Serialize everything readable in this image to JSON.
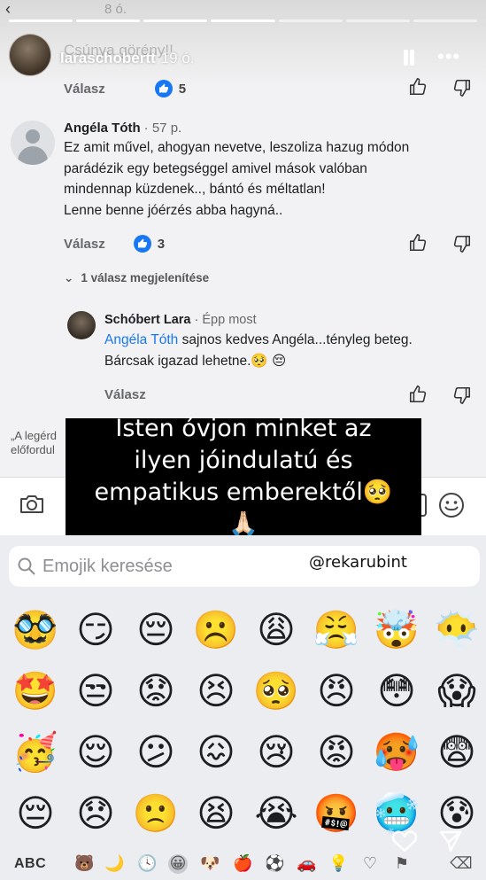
{
  "story": {
    "username": "laraschobertt",
    "time": "19 ó.",
    "top_time": "8 ó.",
    "behind_text": "Csúnya görény!!"
  },
  "comments": [
    {
      "name": "Angéla Tóth",
      "ago": "57 p.",
      "lines": [
        "Ez amit művel, ahogyan nevetve, leszoliza hazug módon",
        "parádézik egy betegséggel amivel mások valóban",
        "mindennap küzdenek.., bántó és méltatlan!",
        "Lenne benne jóérzés abba hagyná.."
      ],
      "reply_label": "Válasz",
      "likes": "3"
    }
  ],
  "first_row": {
    "reply_label": "Válasz",
    "likes": "5"
  },
  "replies_toggle": "1 válasz megjelenítése",
  "reply": {
    "name": "Schóbert Lara",
    "ago": "Épp most",
    "mention": "Angéla Tóth",
    "line1": " sajnos kedves Angéla...tényleg beteg.",
    "line2": "Bárcsak igazad lehetne.🥺 😔",
    "reply_label": "Válasz"
  },
  "quote_text": {
    "line1": "„A legérd",
    "line2": "előfordul"
  },
  "caption": "Isten óvjon minket az ilyen jóindulatú és empatikus emberektől🥺🙏🏻",
  "keyboard": {
    "search_placeholder": "Emojik keresése",
    "handle_tag": "@rekarubint",
    "abc_label": "ABC",
    "emojis": [
      "🥸",
      "😏",
      "😔",
      "☹️",
      "😩",
      "😤",
      "🤯",
      "😶‍🌫️",
      "🤩",
      "😒",
      "😟",
      "😣",
      "🥺",
      "😠",
      "😳",
      "😱",
      "🥳",
      "😌",
      "😕",
      "😖",
      "😢",
      "😡",
      "🥵",
      "😨",
      "😔",
      "😞",
      "🙁",
      "😫",
      "😭",
      "🤬",
      "🥶",
      "😰"
    ],
    "categories": [
      "🐻",
      "🌙",
      "🕓",
      "😀",
      "🐶",
      "🍎",
      "⚽",
      "🚗",
      "💡",
      "♡",
      "⚑",
      "⌫"
    ]
  },
  "colors": {
    "like_blue": "#1877f2",
    "caption_bg": "#000000"
  }
}
